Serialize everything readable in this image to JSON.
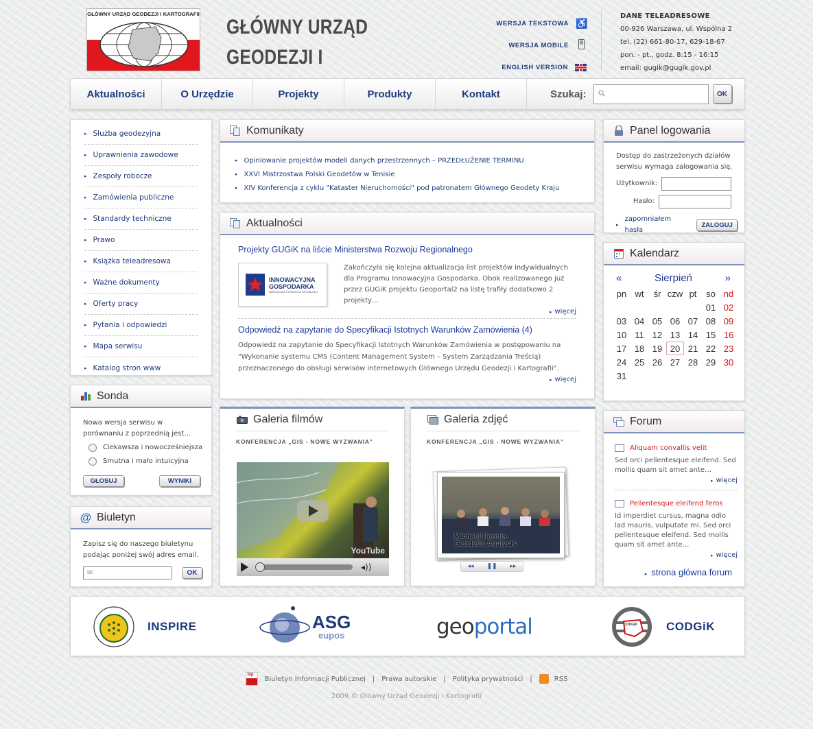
{
  "logo": {
    "text": "GŁÓWNY URZĄD GEODEZJI I KARTOGRAFII"
  },
  "site_title": {
    "line1": "GŁÓWNY URZĄD",
    "line2": "GEODEZJI I KARTOGRAFII"
  },
  "quick_links": [
    {
      "label": "WERSJA TEKSTOWA",
      "icon": "wheelchair-icon"
    },
    {
      "label": "WERSJA MOBILE",
      "icon": "mobile-phone-icon"
    },
    {
      "label": "ENGLISH VERSION",
      "icon": "uk-flag-icon"
    }
  ],
  "contact": {
    "title": "DANE TELEADRESOWE",
    "address": "00-926 Warszawa, ul. Wspólna 2",
    "phone": "tel. (22) 661-80-17, 629-18-67",
    "hours": "pon. - pt., godz. 8:15 - 16:15",
    "email": "email: gugik@gugik.gov.pl"
  },
  "nav": {
    "items": [
      "Aktualności",
      "O Urzędzie",
      "Projekty",
      "Produkty",
      "Kontakt"
    ],
    "search_label": "Szukaj:",
    "search_button": "OK"
  },
  "left_menu": [
    "Służba geodezyjna",
    "Uprawnienia zawodowe",
    "Zespoły robocze",
    "Zamówienia publiczne",
    "Standardy techniczne",
    "Prawo",
    "Książka teleadresowa",
    "Ważne dokumenty",
    "Oferty pracy",
    "Pytania i odpowiedzi",
    "Mapa serwisu",
    "Katalog stron www"
  ],
  "poll": {
    "title": "Sonda",
    "question": "Nowa wersja serwisu w porównaniu z poprzednią jest…",
    "options": [
      "Ciekawsza i nowocześniejsza",
      "Smutna i mało intuicyjna"
    ],
    "vote_button": "GŁOSUJ",
    "results_button": "WYNIKI"
  },
  "newsletter": {
    "title": "Biuletyn",
    "text": "Zapisz się do naszego biuletynu podając poniżej swój adres email.",
    "button": "OK"
  },
  "komunikaty": {
    "title": "Komunikaty",
    "items": [
      "Opiniowanie projektów modeli danych przestrzennych – PRZEDŁUŻENIE TERMINU",
      "XXVI Mistrzostwa Polski Geodetów w Tenisie",
      "XIV Konferencja z cyklu \"Kataster Nieruchomości\" pod patronatem Głównego Geodety Kraju"
    ]
  },
  "aktualnosci": {
    "title": "Aktualności",
    "articles": [
      {
        "title": "Projekty GUGiK na liście Ministerstwa Rozwoju Regionalnego",
        "image_label_1": "INNOWACYJNA",
        "image_label_2": "GOSPODARKA",
        "image_label_3": "NARODOWA STRATEGIA SPÓJNOŚCI",
        "text": "Zakończyła się kolejna aktualizacja list projektów indywidualnych dla Programu Innowacyjna Gospodarka. Obok realizowanego już przez GUGiK projektu Geoportal2  na listę trafiły dodatkowo 2 projekty…",
        "more": "więcej"
      },
      {
        "title": "Odpowiedź na zapytanie do Specyfikacji Istotnych Warunków Zamówienia (4)",
        "text": "Odpowiedź na zapytanie do Specyfikacji Istotnych Warunków Zamówienia w postępowaniu na \"Wykonanie systemu CMS (Content Management System – System Zarządzania Treścią) przeznaczonego do obsługi serwisów internetowych Głównego Urzędu Geodezji i Kartografii\".",
        "more": "więcej"
      }
    ]
  },
  "film_gallery": {
    "title": "Galeria filmów",
    "subtitle": "KONFERENCJA „GIS - NOWE WYZWANIA”",
    "watermark": "YouTube"
  },
  "photo_gallery": {
    "title": "Galeria zdjęć",
    "subtitle": "KONFERENCJA „GIS - NOWE WYZWANIA”",
    "caption_1": "Michael Dennis",
    "caption_2": "Geodetic Analysis"
  },
  "login": {
    "title": "Panel logowania",
    "text": "Dostęp do zastrzeżonych działów serwisu wymaga zalogowania się.",
    "user_label": "Użytkownik:",
    "password_label": "Hasło:",
    "forgot": "zapomniałem hasła",
    "button": "ZALOGUJ"
  },
  "calendar": {
    "title": "Kalendarz",
    "prev": "«",
    "next": "»",
    "month": "Sierpień",
    "days": [
      "pn",
      "wt",
      "śr",
      "czw",
      "pt",
      "so",
      "nd"
    ],
    "weeks": [
      [
        "",
        "",
        "",
        "",
        "",
        "01",
        "02"
      ],
      [
        "03",
        "04",
        "05",
        "06",
        "07",
        "08",
        "09"
      ],
      [
        "10",
        "11",
        "12",
        "13",
        "14",
        "15",
        "16"
      ],
      [
        "17",
        "18",
        "19",
        "20",
        "21",
        "22",
        "23"
      ],
      [
        "24",
        "25",
        "26",
        "27",
        "28",
        "29",
        "30"
      ],
      [
        "31",
        "",
        "",
        "",
        "",
        "",
        ""
      ]
    ],
    "today": "20"
  },
  "forum": {
    "title": "Forum",
    "posts": [
      {
        "title": "Aliquam convallis velit",
        "text": "Sed orci pellentesque eleifend. Sed mollis quam sit amet ante…",
        "more": "więcej"
      },
      {
        "title": "Pellentesque eleifend feros",
        "text": "Id imperdiet cursus, magna odio lad mauris, vulputate mi. Sed orci pellentesque eleifend. Sed mollis quam sit amet ante…",
        "more": "więcej"
      }
    ],
    "main_link": "strona główna forum"
  },
  "partners": {
    "inspire": "INSPIRE",
    "asg": "ASG",
    "asg_sub": "eupos",
    "geo_a": "geo",
    "geo_b": "portal",
    "codgik": "CODGiK",
    "codgik_badge": "CODGiK"
  },
  "footer": {
    "bip_badge": "bip",
    "links": [
      "Biuletyn Informacji Publicznej",
      "Prawa autorskie",
      "Polityka prywatności",
      "RSS"
    ],
    "copyright": "2009 © Główny Urząd Geodezji i Kartografii"
  },
  "colors": {
    "accent_blue": "#1d3a7a",
    "red": "#d0161b",
    "panel_rule": "#7b93bd"
  }
}
